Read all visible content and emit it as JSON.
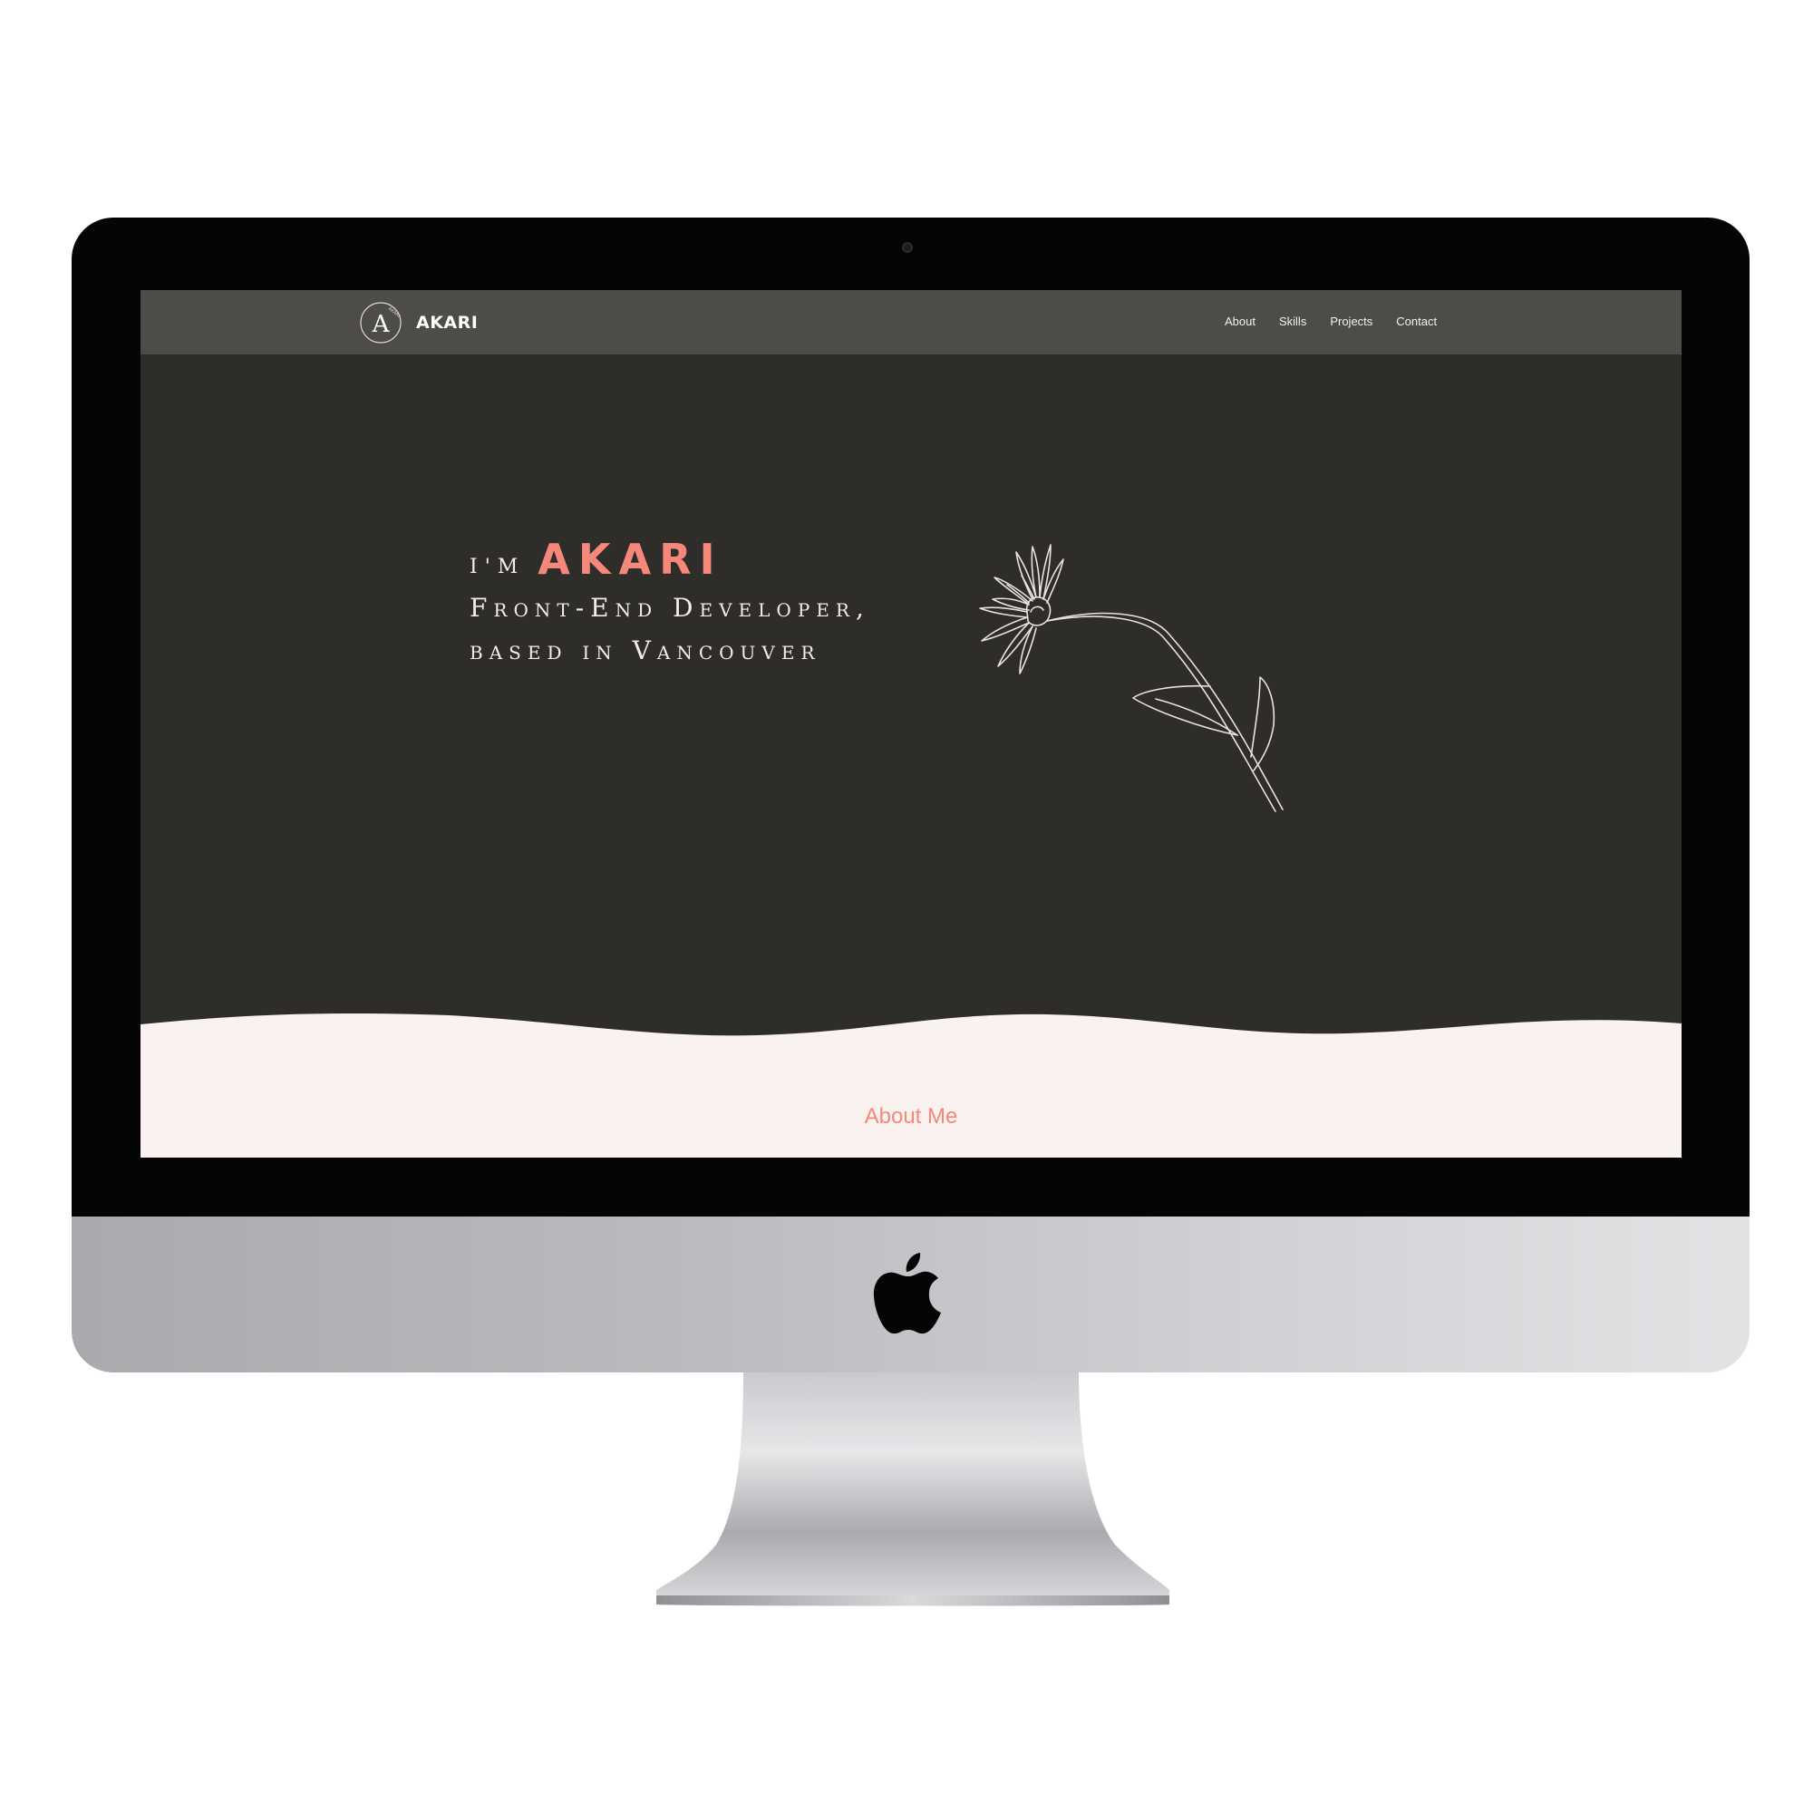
{
  "navbar": {
    "brand_name": "AKARI",
    "logo_letter": "A",
    "logo_arc_text": "AKARI",
    "links": [
      {
        "label": "About"
      },
      {
        "label": "Skills"
      },
      {
        "label": "Projects"
      },
      {
        "label": "Contact"
      }
    ]
  },
  "hero": {
    "intro": "I'M",
    "name": "AKARI",
    "role_line": "Front-End Developer,",
    "location_line": "based in Vancouver"
  },
  "about": {
    "heading": "About Me"
  },
  "colors": {
    "accent": "#f5877b",
    "hero_bg": "#2e2d2a",
    "navbar_bg": "#4d4c48",
    "section_bg": "#f9f2ee"
  },
  "icons": {
    "brand": "akari-logo-icon",
    "decoration": "daisy-flower-icon",
    "device": "apple-logo-icon"
  }
}
